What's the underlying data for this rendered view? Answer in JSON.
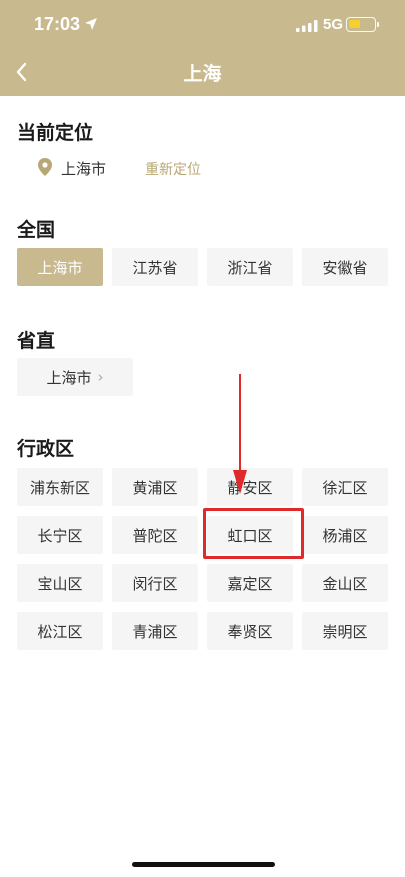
{
  "status_bar": {
    "time": "17:03",
    "network": "5G"
  },
  "nav": {
    "title": "上海"
  },
  "current_location": {
    "heading": "当前定位",
    "city": "上海市",
    "relocate": "重新定位"
  },
  "nationwide": {
    "heading": "全国",
    "items": [
      "上海市",
      "江苏省",
      "浙江省",
      "安徽省"
    ],
    "selected": "上海市"
  },
  "province_direct": {
    "heading": "省直",
    "item": "上海市"
  },
  "districts": {
    "heading": "行政区",
    "items": [
      "浦东新区",
      "黄浦区",
      "静安区",
      "徐汇区",
      "长宁区",
      "普陀区",
      "虹口区",
      "杨浦区",
      "宝山区",
      "闵行区",
      "嘉定区",
      "金山区",
      "松江区",
      "青浦区",
      "奉贤区",
      "崇明区"
    ],
    "highlighted": "虹口区"
  },
  "colors": {
    "accent": "#c9b98f",
    "highlight": "#e0292b",
    "chip_bg": "#f5f5f5"
  }
}
